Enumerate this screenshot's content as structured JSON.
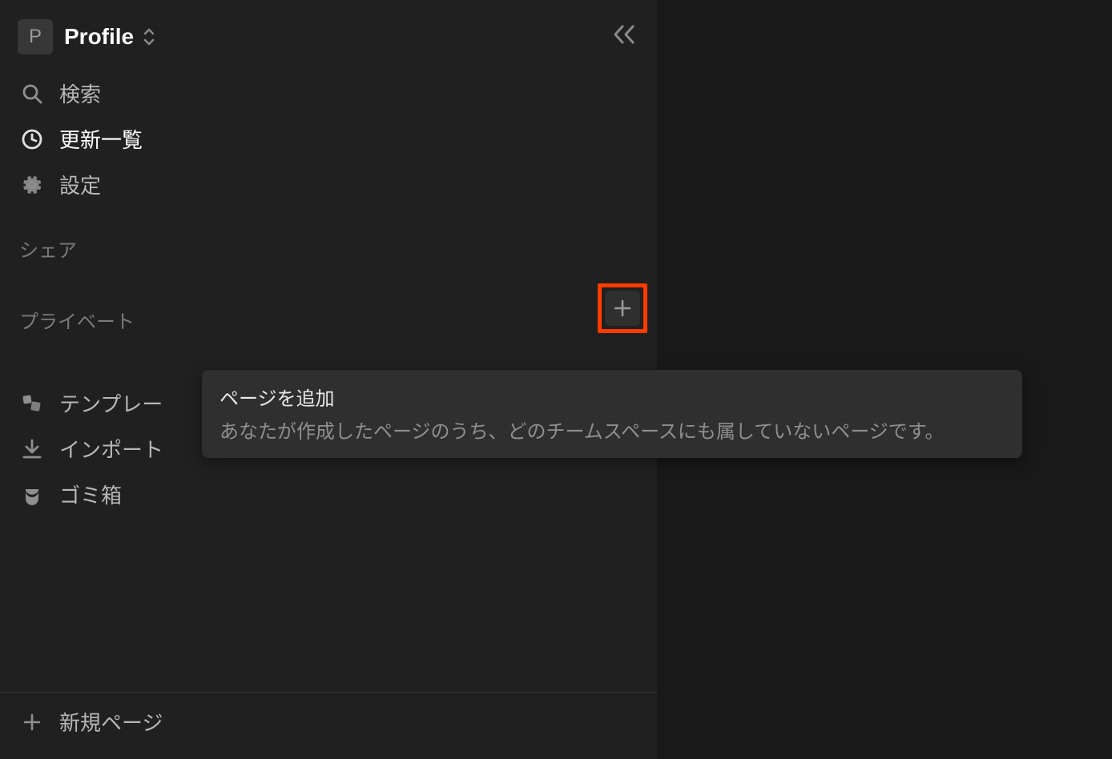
{
  "workspace": {
    "avatar_letter": "P",
    "name": "Profile"
  },
  "nav": {
    "search": "検索",
    "updates": "更新一覧",
    "settings": "設定"
  },
  "sections": {
    "share": "シェア",
    "private": "プライベート"
  },
  "bottom": {
    "templates": "テンプレー",
    "import": "インポート",
    "trash": "ゴミ箱"
  },
  "new_page": "新規ページ",
  "tooltip": {
    "title": "ページを追加",
    "description": "あなたが作成したページのうち、どのチームスペースにも属していないページです。"
  }
}
